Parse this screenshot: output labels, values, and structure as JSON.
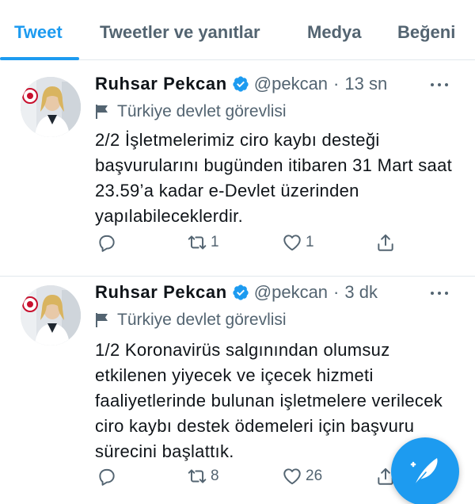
{
  "tabs": [
    {
      "label": "Tweet",
      "active": true
    },
    {
      "label": "Tweetler ve yanıtlar",
      "active": false
    },
    {
      "label": "Medya",
      "active": false
    },
    {
      "label": "Beğeni",
      "active": false
    }
  ],
  "tweets": [
    {
      "author_name": "Ruhsar Pekcan",
      "handle": "@pekcan",
      "time": "13 sn",
      "label": "Türkiye devlet görevlisi",
      "text": "2/2 İşletmelerimiz ciro kaybı desteği başvurularını bugünden itibaren 31 Mart saat 23.59’a kadar e-Devlet üzerinden yapılabileceklerdir.",
      "retweets": "1",
      "likes": "1",
      "reply_count": ""
    },
    {
      "author_name": "Ruhsar Pekcan",
      "handle": "@pekcan",
      "time": "3 dk",
      "label": "Türkiye devlet görevlisi",
      "text": "1/2 Koronavirüs salgınından olumsuz etkilenen yiyecek ve içecek hizmeti faaliyetlerinde bulunan işletmelere verilecek ciro kaybı destek ödemeleri için başvuru sürecini başlattık.",
      "retweets": "8",
      "likes": "26",
      "reply_count": ""
    }
  ],
  "separator": "·",
  "icons": {
    "verified": "verified-badge-icon",
    "flag": "flag-icon",
    "reply": "reply-icon",
    "retweet": "retweet-icon",
    "like": "heart-icon",
    "share": "share-icon",
    "compose": "compose-tweet-icon"
  },
  "colors": {
    "accent": "#1d9bf0",
    "secondary_text": "#536471",
    "primary_text": "#0f1419",
    "divider": "#e1e8ed"
  }
}
